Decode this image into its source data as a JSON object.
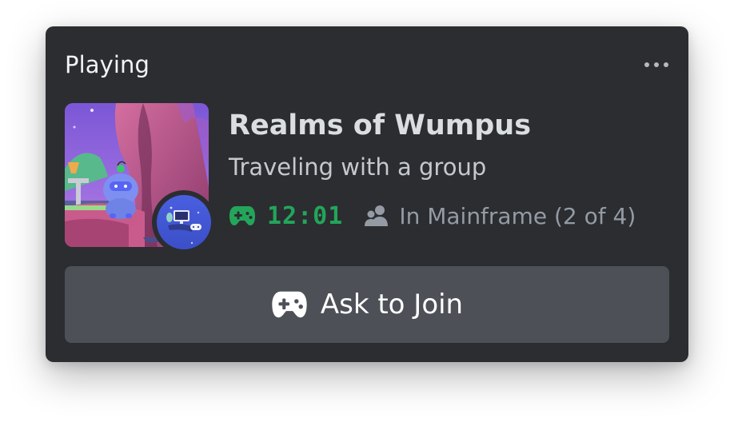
{
  "activity": {
    "header_label": "Playing",
    "more_icon": "more-horizontal-icon",
    "game_title": "Realms of Wumpus",
    "state": "Traveling with a group",
    "elapsed_time": "12:01",
    "party_text": "In Mainframe (2 of 4)",
    "join_label": "Ask to Join",
    "icons": {
      "timer": "gamepad-icon",
      "party": "party-members-icon",
      "join": "gamepad-icon"
    }
  },
  "colors": {
    "card_background": "#2b2d31",
    "timer_green": "#23a55a",
    "button_background": "#4e5058",
    "muted_text": "#949ba4"
  }
}
